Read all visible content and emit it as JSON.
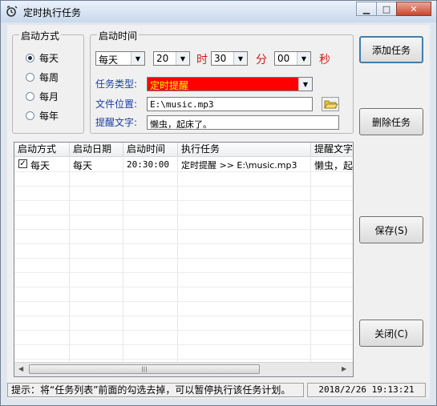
{
  "window": {
    "title": "定时执行任务"
  },
  "start_mode": {
    "group_title": "启动方式",
    "options": [
      {
        "label": "每天",
        "selected": true
      },
      {
        "label": "每周",
        "selected": false
      },
      {
        "label": "每月",
        "selected": false
      },
      {
        "label": "每年",
        "selected": false
      }
    ]
  },
  "start_time": {
    "group_title": "启动时间",
    "frequency": "每天",
    "hour": "20",
    "hour_unit": "时",
    "minute": "30",
    "minute_unit": "分",
    "second": "00",
    "second_unit": "秒",
    "task_type_label": "任务类型:",
    "task_type_value": "定时提醒",
    "file_label": "文件位置:",
    "file_value": "E:\\music.mp3",
    "reminder_label": "提醒文字:",
    "reminder_value": "懒虫，起床了。"
  },
  "buttons": {
    "add": "添加任务",
    "delete": "删除任务",
    "save": "保存(S)",
    "close": "关闭(C)"
  },
  "task_list": {
    "columns": [
      "启动方式",
      "启动日期",
      "启动时间",
      "执行任务",
      "提醒文字"
    ],
    "rows": [
      {
        "checked": true,
        "mode": "每天",
        "date": "每天",
        "time": "20:30:00",
        "task": "定时提醒 >> E:\\music.mp3",
        "text": "懒虫，起床了。"
      }
    ]
  },
  "status": {
    "hint": "提示：将“任务列表”前面的勾选去掉，可以暂停执行该任务计划。",
    "datetime": "2018/2/26 19:13:21"
  },
  "colors": {
    "task_type_bg": "#ff0000",
    "task_type_text": "#ffff00",
    "label_blue": "#1b3fa3",
    "unit_red": "#d41a1a"
  }
}
